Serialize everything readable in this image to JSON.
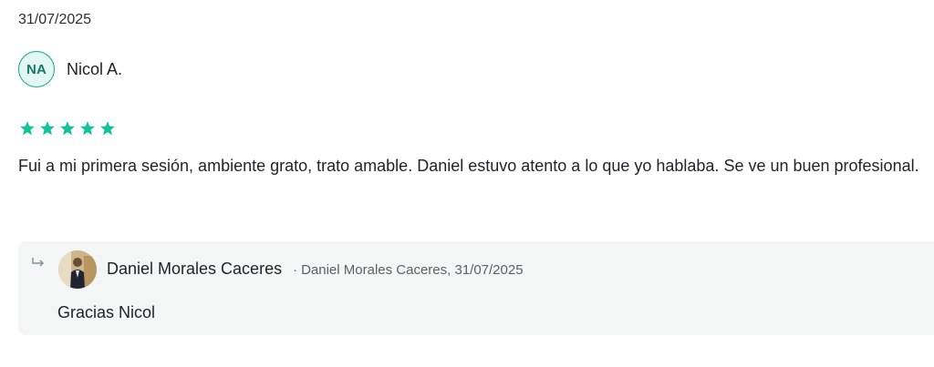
{
  "review": {
    "date": "31/07/2025",
    "author": {
      "initials": "NA",
      "name": "Nicol A."
    },
    "rating": {
      "value": 5,
      "max": 5
    },
    "text": "Fui a mi primera sesión, ambiente grato, trato amable. Daniel estuvo atento a lo que yo hablaba. Se ve un buen profesional."
  },
  "reply": {
    "icon": "reply-arrow-icon",
    "author": "Daniel Morales Caceres",
    "separator": "·",
    "meta": "Daniel Morales Caceres, 31/07/2025",
    "text": "Gracias Nicol"
  },
  "colors": {
    "star": "#13c29a",
    "avatar_border": "#19a48d",
    "avatar_bg": "#e3f7f2",
    "reply_bg": "#f4f6f5"
  }
}
